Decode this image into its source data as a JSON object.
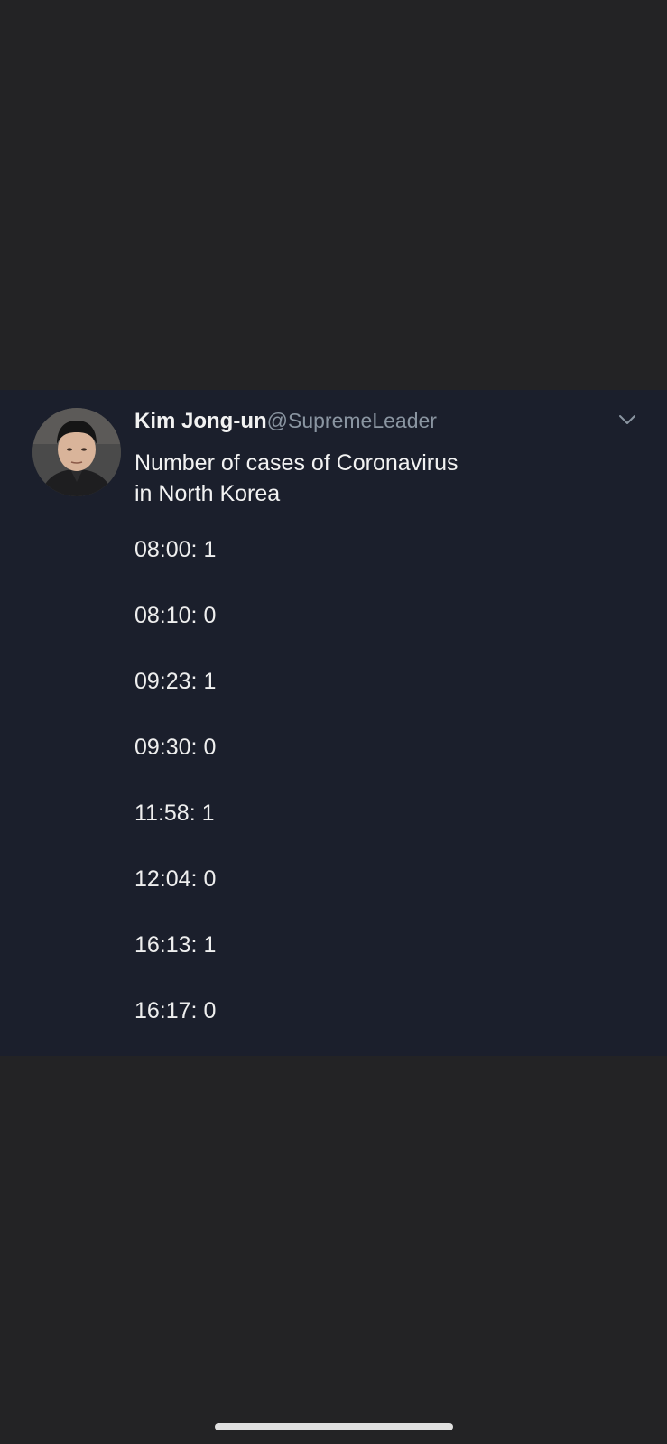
{
  "tweet": {
    "author_name": "Kim Jong-un",
    "author_handle": "@SupremeLeader",
    "avatar_icon": "profile-photo",
    "menu_icon": "chevron-down-icon",
    "text_lines": [
      "Number of cases of Coronavirus",
      "in North Korea"
    ],
    "entries": [
      "08:00: 1",
      "08:10: 0",
      "09:23: 1",
      "09:30: 0",
      "11:58: 1",
      "12:04: 0",
      "16:13: 1",
      "16:17: 0"
    ]
  },
  "colors": {
    "page_background": "#232325",
    "tweet_background": "#1b1f2c",
    "handle": "#8a95a1",
    "text": "#f2f2f2"
  }
}
